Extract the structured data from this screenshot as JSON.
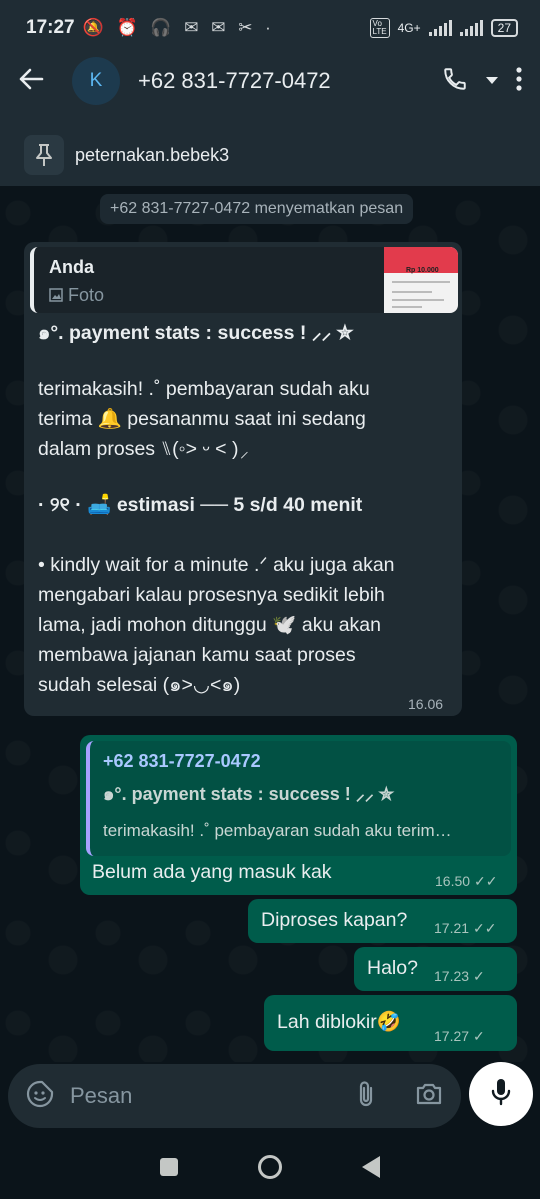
{
  "status_bar": {
    "time": "17:27",
    "left_icons": "🔕 ⏰ 🎧 ✉ ✉ ✂ ·",
    "network": "4G+",
    "battery": "27"
  },
  "header": {
    "avatar_letter": "K",
    "contact": "+62 831-7727-0472"
  },
  "pinned": {
    "text": "peternakan.bebek3"
  },
  "system_message": "+62 831-7727-0472 menyematkan pesan",
  "incoming": {
    "quote_author": "Anda",
    "quote_type": "Foto",
    "thumb_amount": "Rp 10.000",
    "heading": "๑°. payment stats : success ! ⸝⸝ ✮",
    "para1": "terimakasih! .˚ pembayaran sudah aku\nterima 🔔 pesananmu saat ini sedang\ndalam proses ⑊(◦˃ ᵕ ˂ )⸝",
    "estimate_prefix": "· ୨୧ · 🛋️ ",
    "estimate": "estimasi ── 5 s/d 40 menit",
    "para2": " • kindly wait for a minute .ᐟ aku juga akan\nmengabari kalau prosesnya sedikit lebih\nlama,  jadi mohon ditunggu 🕊️ aku akan\nmembawa jajanan kamu saat proses\nsudah selesai (๑>◡<๑)",
    "time": "16.06"
  },
  "outgoing": [
    {
      "quote_name": "+62 831-7727-0472",
      "quote_title": "๑°. payment stats : success ! ⸝⸝ ✮",
      "quote_snippet": "terimakasih! .˚ pembayaran sudah aku terim…",
      "text": "Belum ada yang masuk kak",
      "time": "16.50",
      "status": "read"
    },
    {
      "text": "Diproses kapan?",
      "time": "17.21",
      "status": "read"
    },
    {
      "text": "Halo?",
      "time": "17.23",
      "status": "sent"
    },
    {
      "text": "Lah diblokir🤣",
      "time": "17.27",
      "status": "sent"
    }
  ],
  "input": {
    "placeholder": "Pesan"
  },
  "icons": {
    "back": "arrow-left-icon",
    "call": "phone-icon",
    "call_menu": "caret-down-icon",
    "more": "more-vert-icon",
    "pin": "pin-icon",
    "emoji": "sticker-icon",
    "attach": "paperclip-icon",
    "camera": "camera-icon",
    "mic": "mic-icon"
  },
  "colors": {
    "incoming_bubble": "#202c33",
    "outgoing_bubble": "#005c4b",
    "accent": "#00a884"
  }
}
